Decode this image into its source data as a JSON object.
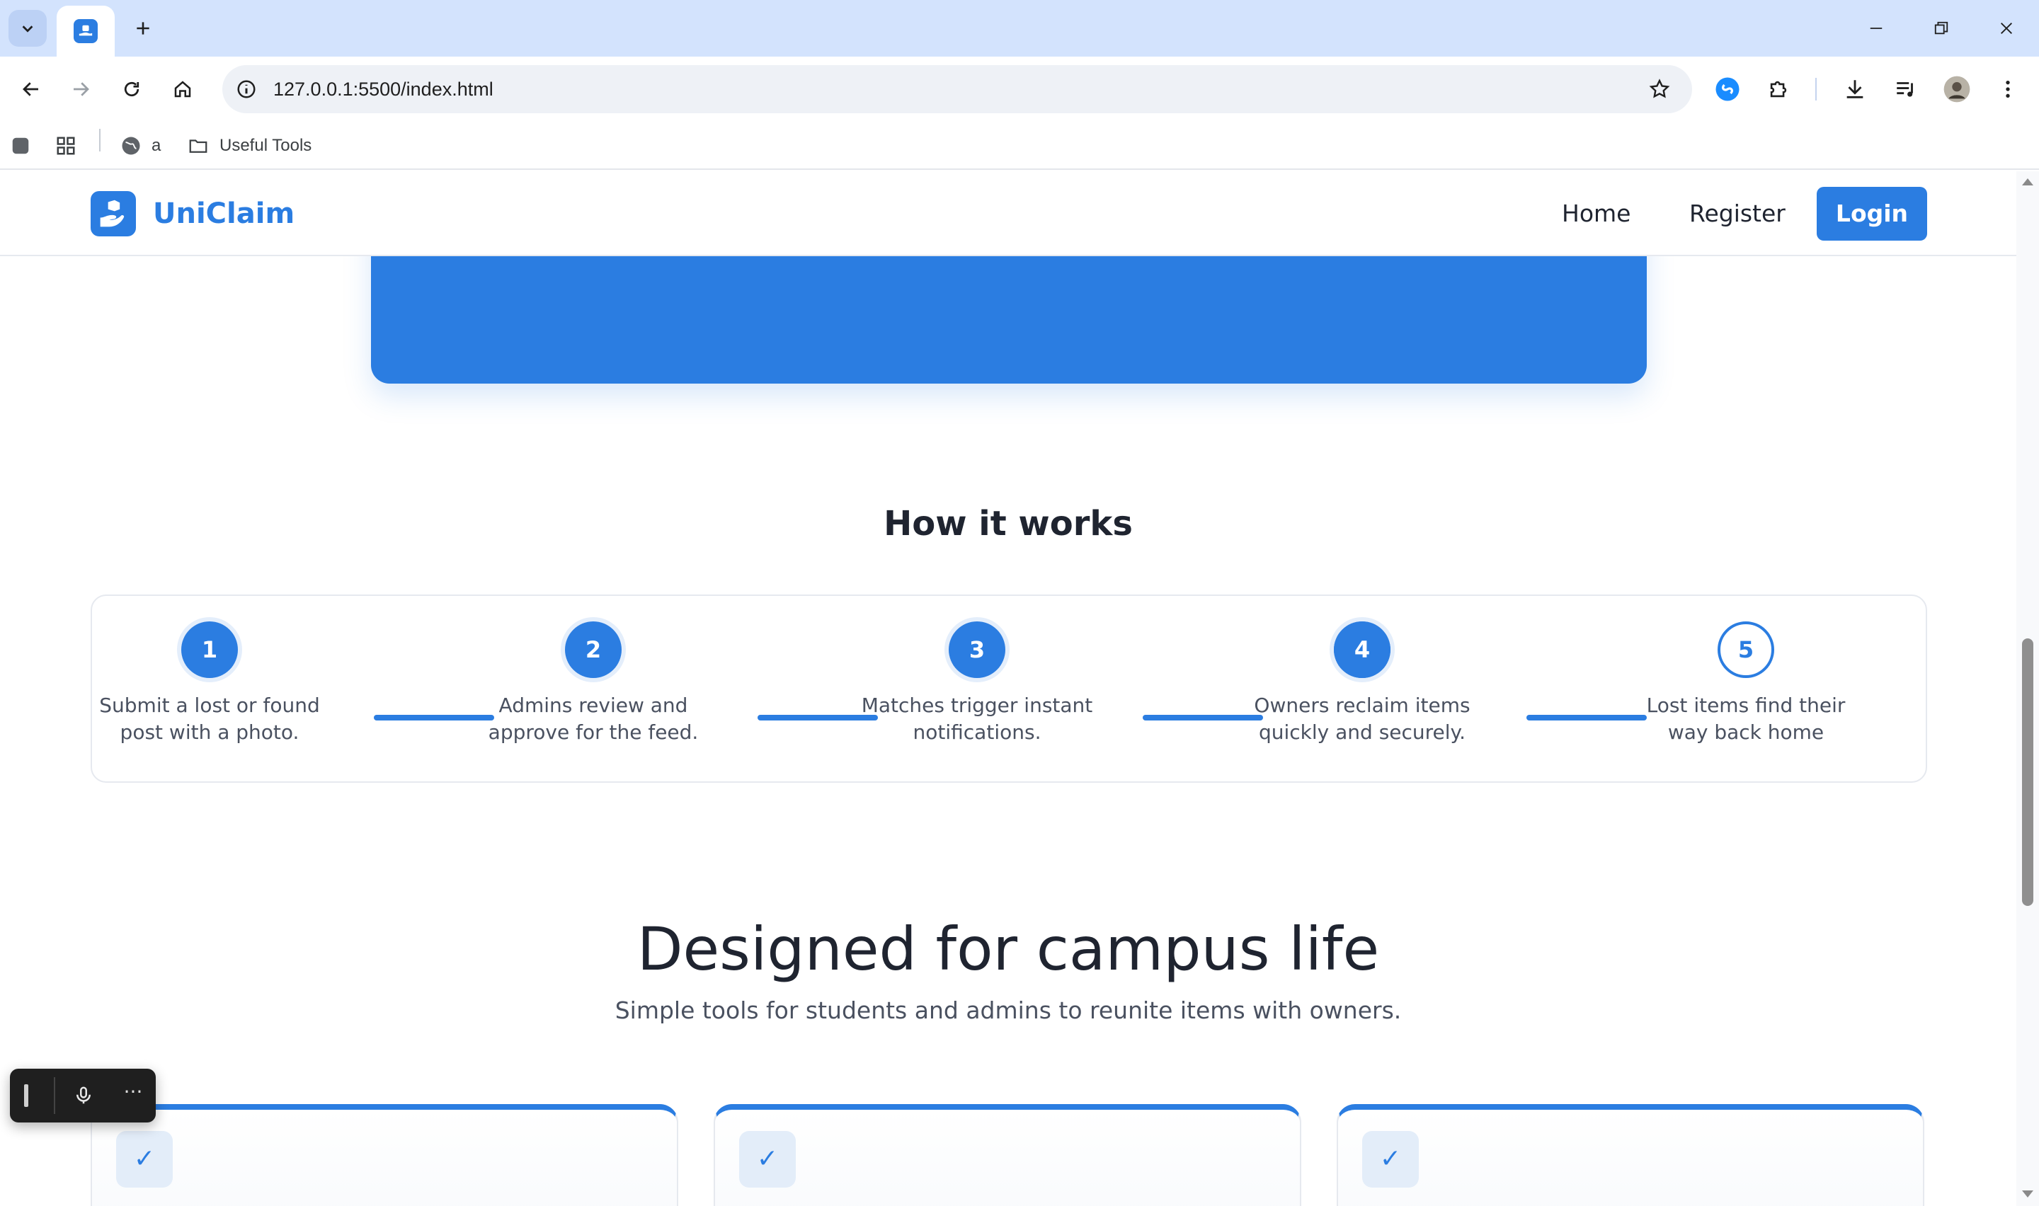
{
  "browser": {
    "url": "127.0.0.1:5500/index.html",
    "bookmarks": [
      {
        "label": ""
      },
      {
        "label": ""
      },
      {
        "label": "a"
      },
      {
        "label": "Useful Tools"
      }
    ]
  },
  "site": {
    "brand": "UniClaim",
    "nav": {
      "home": "Home",
      "register": "Register",
      "login": "Login"
    }
  },
  "how_it_works": {
    "title": "How it works",
    "steps": [
      {
        "number": "1",
        "text": "Submit a lost or found post with a photo."
      },
      {
        "number": "2",
        "text": "Admins review and approve for the feed."
      },
      {
        "number": "3",
        "text": "Matches trigger instant notifications."
      },
      {
        "number": "4",
        "text": "Owners reclaim items quickly and securely."
      },
      {
        "number": "5",
        "text": "Lost items find their way back home"
      }
    ]
  },
  "features": {
    "title": "Designed for campus life",
    "subtitle": "Simple tools for students and admins to reunite items with owners.",
    "check_glyph": "✓"
  },
  "voice_widget": {
    "more_glyph": "···"
  },
  "colors": {
    "brand_blue": "#2b7de1",
    "tabbar": "#d3e3fd"
  }
}
